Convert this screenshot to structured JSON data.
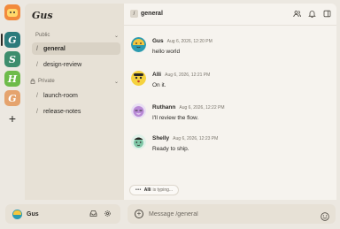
{
  "rail": {
    "servers": [
      {
        "letter": "G",
        "color": "#2c7b7c"
      },
      {
        "letter": "S",
        "color": "#3d8d6d"
      },
      {
        "letter": "H",
        "color": "#6dbb4a"
      },
      {
        "letter": "G",
        "color": "#e5a36d"
      }
    ],
    "add_label": "+"
  },
  "workspace": {
    "title": "Gus"
  },
  "sections": [
    {
      "label": "Public",
      "channels": [
        {
          "name": "general",
          "active": true
        },
        {
          "name": "design-review",
          "active": false
        }
      ]
    },
    {
      "label": "Private",
      "channels": [
        {
          "name": "launch-room",
          "active": false
        },
        {
          "name": "release-notes",
          "active": false
        }
      ]
    }
  ],
  "user": {
    "name": "Gus"
  },
  "channel": {
    "title": "general"
  },
  "messages": [
    {
      "author": "Gus",
      "time": "Aug 6, 2026, 12:20 PM",
      "text": "hello world",
      "avatar_color": "#f5c63e"
    },
    {
      "author": "Alli",
      "time": "Aug 6, 2026, 12:21 PM",
      "text": "On it.",
      "avatar_color": "#f5d23e"
    },
    {
      "author": "Ruthann",
      "time": "Aug 6, 2026, 12:22 PM",
      "text": "I'll review the flow.",
      "avatar_color": "#b98ad6"
    },
    {
      "author": "Shelly",
      "time": "Aug 6, 2026, 12:23 PM",
      "text": "Ready to ship.",
      "avatar_color": "#7fc7a7"
    }
  ],
  "typing": {
    "dots": "•••",
    "name": "Alli",
    "suffix": "is typing..."
  },
  "composer": {
    "placeholder": "Message /general"
  },
  "icons": {
    "header": [
      "members-icon",
      "bell-icon",
      "panel-icon"
    ],
    "user": [
      "inbox-icon",
      "settings-icon"
    ],
    "composer": [
      "plus-icon",
      "emoji-icon"
    ]
  }
}
